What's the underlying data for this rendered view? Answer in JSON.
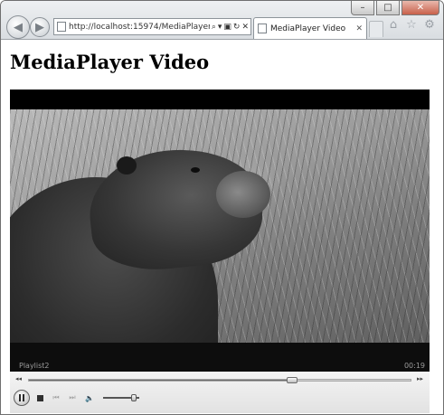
{
  "window": {
    "minimize_glyph": "–",
    "maximize_glyph": "□",
    "close_glyph": "✕"
  },
  "nav": {
    "back_glyph": "◀",
    "forward_glyph": "▶"
  },
  "address_bar": {
    "url": "http://localhost:15974/MediaPlayerV",
    "search_glyph": "⌕",
    "dropdown_glyph": "▾",
    "compat_glyph": "▣",
    "refresh_glyph": "↻",
    "stop_glyph": "✕"
  },
  "tab": {
    "label": "MediaPlayer Video",
    "close_glyph": "✕"
  },
  "toolbar": {
    "home_glyph": "⌂",
    "favorites_glyph": "☆",
    "tools_glyph": "⚙"
  },
  "page": {
    "title": "MediaPlayer Video"
  },
  "player": {
    "playlist_label": "Playlist2",
    "time": "00:19",
    "seek_back_glyph": "◂◂",
    "seek_forward_glyph": "▸▸",
    "seek_progress": 0.69,
    "previous_glyph": "⏮",
    "next_glyph": "⏭",
    "mute_glyph": "🔈",
    "volume_level": 0.85
  }
}
